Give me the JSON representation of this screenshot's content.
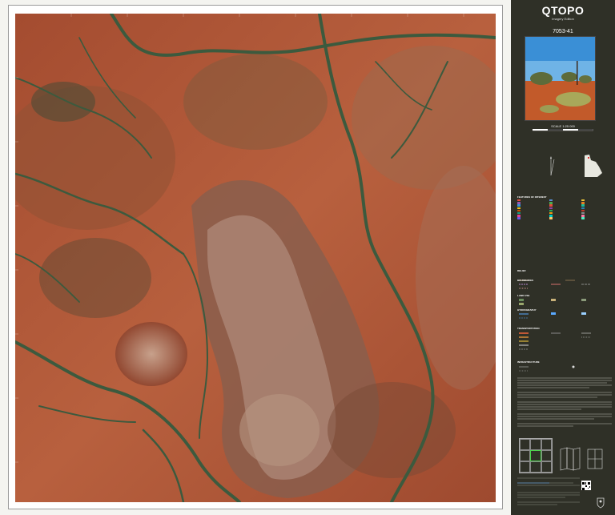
{
  "brand": {
    "title": "QTOPO",
    "subtitle": "Imagery Edition"
  },
  "sheet": {
    "number": "7053-41"
  },
  "scale": {
    "label": "SCALE 1:25 000"
  },
  "colors": {
    "panel": "#2f3027",
    "terrain": "#b35a3a",
    "vegetation": "#3c5a3e",
    "index_highlight": "#4dd14d"
  },
  "sections": {
    "legend_head": "FEATURES OF INTEREST",
    "relief": "RELIEF",
    "boundaries": "BOUNDARIES",
    "land_use": "LAND USE",
    "hydrography": "HYDROGRAPHY",
    "transportation": "TRANSPORTATION",
    "infrastructure": "INFRASTRUCTURE"
  },
  "icons": {
    "crest": "queensland-crest-icon",
    "qr": "qr-code-icon",
    "locator": "queensland-locator-map-icon"
  }
}
